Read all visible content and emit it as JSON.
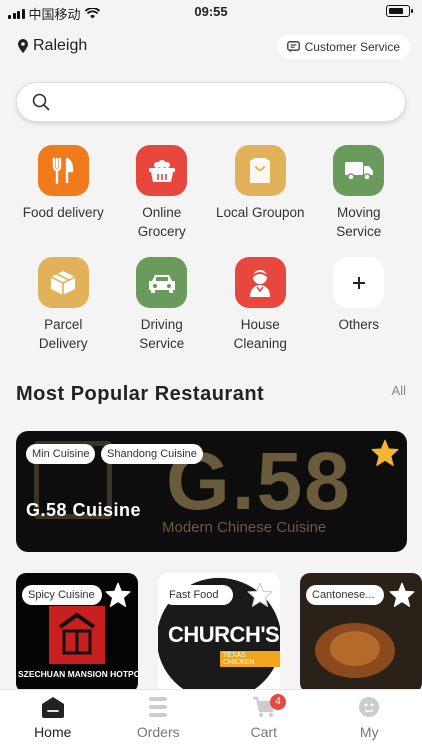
{
  "status_bar": {
    "carrier": "中国移动",
    "time": "09:55"
  },
  "header": {
    "location": "Raleigh",
    "customer_service": "Customer Service"
  },
  "search": {
    "placeholder": "",
    "value": ""
  },
  "services": [
    {
      "label": "Food delivery",
      "icon": "fork-knife-icon",
      "color": "#f07a1c"
    },
    {
      "label": "Online Grocery",
      "icon": "basket-icon",
      "color": "#e8473d"
    },
    {
      "label": "Local Groupon",
      "icon": "shopping-bag-icon",
      "color": "#e2b25a"
    },
    {
      "label": "Moving Service",
      "icon": "truck-icon",
      "color": "#6a9a5c"
    },
    {
      "label": "Parcel Delivery",
      "icon": "box-icon",
      "color": "#e2b25a"
    },
    {
      "label": "Driving Service",
      "icon": "car-icon",
      "color": "#6a9a5c"
    },
    {
      "label": "House Cleaning",
      "icon": "cleaner-icon",
      "color": "#e8473d"
    },
    {
      "label": "Others",
      "icon": "plus-icon",
      "color": "#ffffff"
    }
  ],
  "section": {
    "title": "Most Popular Restaurant",
    "all_label": "All"
  },
  "featured": {
    "name": "G.58 Cuisine",
    "tags": [
      "Min Cuisine",
      "Shandong Cuisine"
    ],
    "banner_text": "G.58",
    "banner_subtext": "Modern Chinese Cuisine"
  },
  "cards": [
    {
      "tag": "Spicy Cuisine",
      "sign_text": "SZECHUAN MANSION HOTPOT"
    },
    {
      "tag": "Fast Food",
      "logo_text": "CHURCH'S",
      "logo_sub": "TEXAS CHICKEN"
    },
    {
      "tag": "Cantonese..."
    }
  ],
  "tabs": [
    {
      "label": "Home",
      "icon": "home-icon",
      "active": true
    },
    {
      "label": "Orders",
      "icon": "list-icon"
    },
    {
      "label": "Cart",
      "icon": "cart-icon",
      "badge": "4"
    },
    {
      "label": "My",
      "icon": "profile-icon"
    }
  ],
  "colors": {
    "accent": "#e8473d",
    "banner_gold": "#6b5b3d",
    "star": "#f2b631"
  }
}
